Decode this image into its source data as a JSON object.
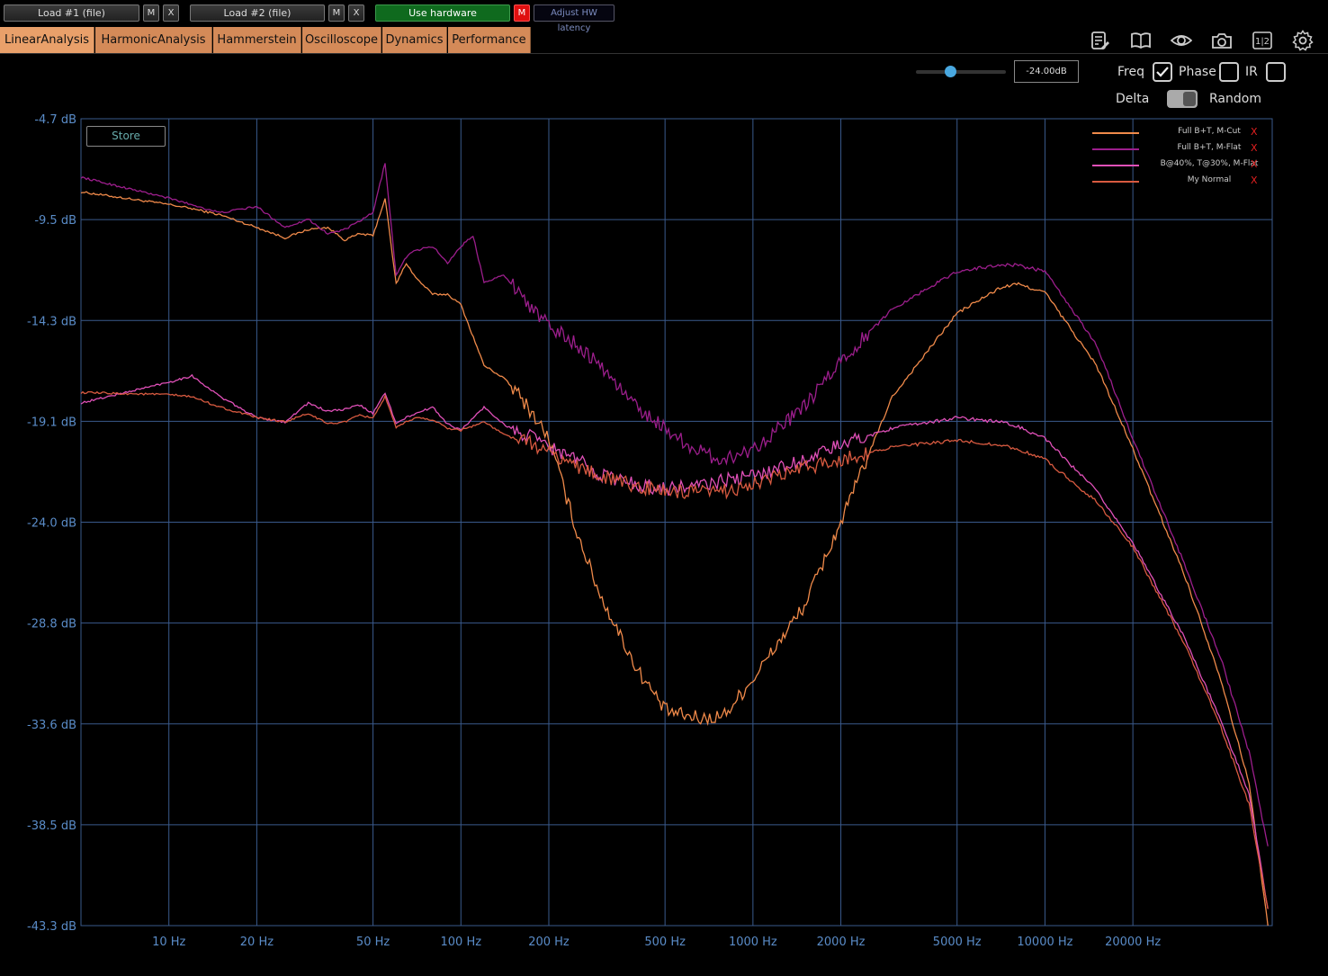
{
  "toolbar": {
    "load1": "Load #1 (file)",
    "load2": "Load #2 (file)",
    "m": "M",
    "x": "X",
    "use_hardware": "Use hardware",
    "hw_m": "M",
    "adjust_latency": "Adjust HW latency"
  },
  "tabs": [
    "LinearAnalysis",
    "HarmonicAnalysis",
    "Hammerstein",
    "Oscilloscope",
    "Dynamics",
    "Performance"
  ],
  "tool_icons": [
    "notes-icon",
    "book-icon",
    "eye-icon",
    "camera-icon",
    "split-1-2-icon",
    "gear-icon"
  ],
  "split_icon_text": "1|2",
  "controls": {
    "level_value": "-24.00dB",
    "freq_label": "Freq",
    "freq_checked": true,
    "phase_label": "Phase",
    "phase_checked": false,
    "ir_label": "IR",
    "ir_checked": false,
    "delta_label": "Delta",
    "random_label": "Random",
    "store_label": "Store"
  },
  "colors": {
    "accent_tab": "#d48a58",
    "grid": "#3a5a8c",
    "axis_text": "#5a8cc8"
  },
  "chart_data": {
    "type": "line",
    "xscale": "log",
    "xlim": [
      5,
      60000
    ],
    "ylim": [
      -43.3,
      -4.7
    ],
    "y_ticks": [
      "-4.7 dB",
      "-9.5 dB",
      "-14.3 dB",
      "-19.1 dB",
      "-24.0 dB",
      "-28.8 dB",
      "-33.6 dB",
      "-38.5 dB",
      "-43.3 dB"
    ],
    "x_ticks": [
      "10 Hz",
      "20 Hz",
      "50 Hz",
      "100 Hz",
      "200 Hz",
      "500 Hz",
      "1000 Hz",
      "2000 Hz",
      "5000 Hz",
      "10000 Hz",
      "20000 Hz"
    ],
    "x_tick_values": [
      10,
      20,
      50,
      100,
      200,
      500,
      1000,
      2000,
      5000,
      10000,
      20000
    ],
    "grid": true,
    "legend": "top-right",
    "series": [
      {
        "name": "Full B+T, M-Cut",
        "color": "#f08a4a",
        "x": [
          5,
          10,
          12,
          15,
          20,
          25,
          30,
          35,
          40,
          45,
          50,
          55,
          60,
          65,
          70,
          80,
          90,
          100,
          120,
          140,
          160,
          180,
          200,
          250,
          300,
          400,
          500,
          600,
          700,
          800,
          1000,
          1500,
          2000,
          3000,
          5000,
          7000,
          8000,
          10000,
          15000,
          20000,
          30000,
          40000,
          50000,
          58000
        ],
        "y": [
          -8.2,
          -8.8,
          -9.0,
          -9.3,
          -9.9,
          -10.4,
          -10.0,
          -9.9,
          -10.5,
          -10.2,
          -10.3,
          -8.5,
          -12.6,
          -11.6,
          -12.3,
          -13.1,
          -13.1,
          -13.6,
          -16.5,
          -17.1,
          -18.0,
          -19.0,
          -20.0,
          -24.5,
          -27.5,
          -31.0,
          -33.0,
          -33.3,
          -33.4,
          -33.2,
          -31.5,
          -28.0,
          -24.0,
          -18.0,
          -14.0,
          -12.8,
          -12.6,
          -13.0,
          -16.5,
          -20.5,
          -26.5,
          -31.5,
          -36.5,
          -43.3
        ]
      },
      {
        "name": "Full B+T, M-Flat",
        "color": "#9c1e8c",
        "x": [
          5,
          10,
          15,
          20,
          25,
          30,
          35,
          40,
          45,
          50,
          55,
          60,
          65,
          70,
          80,
          90,
          100,
          110,
          120,
          140,
          160,
          180,
          200,
          250,
          300,
          400,
          500,
          600,
          700,
          800,
          1000,
          1500,
          2000,
          3000,
          5000,
          7000,
          8000,
          10000,
          15000,
          20000,
          30000,
          40000,
          50000,
          58000
        ],
        "y": [
          -7.5,
          -8.5,
          -9.2,
          -8.9,
          -9.9,
          -9.5,
          -10.2,
          -10.0,
          -9.6,
          -9.2,
          -6.8,
          -12.2,
          -11.3,
          -11.0,
          -10.8,
          -11.6,
          -10.8,
          -10.3,
          -12.5,
          -12.2,
          -13.0,
          -14.0,
          -14.6,
          -15.5,
          -16.5,
          -18.5,
          -19.5,
          -20.3,
          -20.8,
          -21.0,
          -20.5,
          -18.5,
          -16.3,
          -13.8,
          -12.0,
          -11.7,
          -11.7,
          -12.0,
          -15.5,
          -20.0,
          -26.0,
          -30.5,
          -35.0,
          -39.5
        ]
      },
      {
        "name": "B@40%, T@30%, M-Flat",
        "color": "#e050b8",
        "x": [
          5,
          10,
          12,
          15,
          20,
          25,
          30,
          35,
          40,
          45,
          50,
          55,
          60,
          65,
          70,
          80,
          90,
          100,
          120,
          140,
          160,
          180,
          200,
          250,
          300,
          400,
          500,
          600,
          700,
          800,
          1000,
          1500,
          2000,
          3000,
          5000,
          7000,
          8000,
          10000,
          15000,
          20000,
          30000,
          40000,
          50000,
          58000
        ],
        "y": [
          -18.3,
          -17.3,
          -17.0,
          -18.0,
          -19.0,
          -19.2,
          -18.3,
          -18.7,
          -18.6,
          -18.4,
          -18.8,
          -17.8,
          -19.3,
          -19.0,
          -18.8,
          -18.5,
          -19.3,
          -19.6,
          -18.5,
          -19.3,
          -19.8,
          -20.0,
          -20.4,
          -21.0,
          -21.7,
          -22.2,
          -22.4,
          -22.3,
          -22.2,
          -22.0,
          -21.8,
          -21.0,
          -20.3,
          -19.5,
          -19.0,
          -19.2,
          -19.4,
          -20.0,
          -22.5,
          -25.0,
          -29.5,
          -33.5,
          -37.0,
          -42.5
        ]
      },
      {
        "name": "My Normal",
        "color": "#d85a40",
        "x": [
          5,
          10,
          12,
          15,
          20,
          25,
          30,
          35,
          40,
          45,
          50,
          55,
          60,
          65,
          70,
          80,
          90,
          100,
          120,
          140,
          160,
          180,
          200,
          250,
          300,
          400,
          500,
          600,
          700,
          800,
          1000,
          1500,
          2000,
          3000,
          5000,
          7000,
          8000,
          10000,
          15000,
          20000,
          30000,
          40000,
          50000,
          58000
        ],
        "y": [
          -17.8,
          -17.9,
          -18.0,
          -18.5,
          -19.0,
          -19.2,
          -18.8,
          -19.3,
          -19.2,
          -18.9,
          -19.0,
          -18.0,
          -19.5,
          -19.2,
          -19.0,
          -19.1,
          -19.5,
          -19.6,
          -19.2,
          -19.8,
          -20.1,
          -20.3,
          -20.7,
          -21.3,
          -21.8,
          -22.3,
          -22.5,
          -22.6,
          -22.6,
          -22.5,
          -22.2,
          -21.4,
          -21.0,
          -20.4,
          -20.1,
          -20.3,
          -20.5,
          -21.0,
          -23.0,
          -25.2,
          -29.8,
          -33.8,
          -37.5,
          -42.5
        ]
      }
    ]
  }
}
